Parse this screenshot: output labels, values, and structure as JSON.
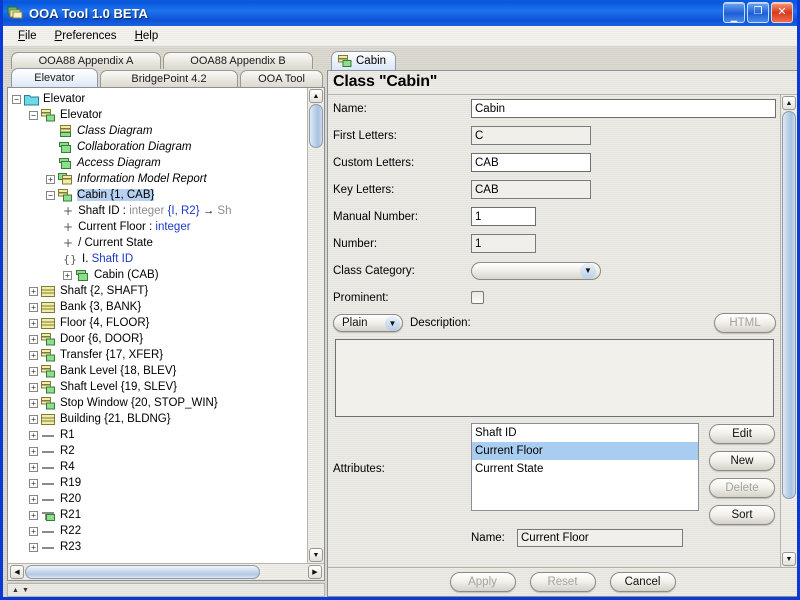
{
  "window": {
    "title": "OOA Tool 1.0 BETA",
    "icon": "app-folder-icon",
    "controls": {
      "minimize": "_",
      "maximize": "□",
      "close": "✕"
    }
  },
  "menubar": {
    "items": [
      "File",
      "Preferences",
      "Help"
    ]
  },
  "left": {
    "tabs_row1": [
      {
        "label": "OOA88 Appendix A",
        "selected": false
      },
      {
        "label": "OOA88 Appendix B",
        "selected": false
      }
    ],
    "tabs_row2": [
      {
        "label": "Elevator",
        "selected": true
      },
      {
        "label": "BridgePoint 4.2",
        "selected": false
      },
      {
        "label": "OOA Tool",
        "selected": false
      }
    ],
    "tree": [
      {
        "indent": 0,
        "toggle": "minus",
        "icon": "folder-cyan-icon",
        "label": "Elevator",
        "italic": false,
        "selected": false
      },
      {
        "indent": 1,
        "toggle": "minus",
        "icon": "stack-green-yellow-icon",
        "label": "Elevator",
        "italic": false,
        "selected": false
      },
      {
        "indent": 2,
        "toggle": "none",
        "icon": "stack-yellow-icon",
        "label": "Class Diagram",
        "italic": true,
        "selected": false
      },
      {
        "indent": 2,
        "toggle": "none",
        "icon": "square-green-icon",
        "label": "Collaboration Diagram",
        "italic": true,
        "selected": false
      },
      {
        "indent": 2,
        "toggle": "none",
        "icon": "square-green-icon",
        "label": "Access Diagram",
        "italic": true,
        "selected": false
      },
      {
        "indent": 2,
        "toggle": "plus",
        "icon": "stack-yellow-green-icon",
        "label": "Information Model Report",
        "italic": true,
        "selected": false
      },
      {
        "indent": 2,
        "toggle": "minus",
        "icon": "stack-green-yellow-icon",
        "label": "Cabin {1, CAB}",
        "italic": false,
        "selected": true
      },
      {
        "indent": 3,
        "toggle": "attr",
        "icon": "none",
        "label": "Shaft ID : integer {I, R2} → Sh",
        "italic": false,
        "selected": false,
        "parts": [
          {
            "t": "Shaft ID : ",
            "c": "black"
          },
          {
            "t": "integer ",
            "c": "gray"
          },
          {
            "t": "{I, R2}",
            "c": "blue"
          },
          {
            "t": " → ",
            "c": "black"
          },
          {
            "t": "Sh",
            "c": "gray"
          }
        ]
      },
      {
        "indent": 3,
        "toggle": "attr",
        "icon": "none",
        "label": "Current Floor : integer",
        "italic": false,
        "selected": false,
        "parts": [
          {
            "t": "Current Floor : ",
            "c": "black"
          },
          {
            "t": "integer",
            "c": "blue"
          }
        ]
      },
      {
        "indent": 3,
        "toggle": "attr",
        "icon": "none",
        "label": "/ Current State",
        "italic": false,
        "selected": false,
        "parts": [
          {
            "t": "/ Current State",
            "c": "black"
          }
        ]
      },
      {
        "indent": 3,
        "toggle": "ident",
        "icon": "none",
        "label": "I. Shaft ID",
        "italic": false,
        "selected": false,
        "parts": [
          {
            "t": "I. ",
            "c": "black"
          },
          {
            "t": "Shaft ID",
            "c": "blue"
          }
        ]
      },
      {
        "indent": 3,
        "toggle": "plus",
        "icon": "square-green-icon",
        "label": "Cabin (CAB)",
        "italic": false,
        "selected": false
      },
      {
        "indent": 1,
        "toggle": "plus",
        "icon": "lines-yellow-icon",
        "label": "Shaft {2, SHAFT}",
        "italic": false,
        "selected": false
      },
      {
        "indent": 1,
        "toggle": "plus",
        "icon": "lines-yellow-icon",
        "label": "Bank {3, BANK}",
        "italic": false,
        "selected": false
      },
      {
        "indent": 1,
        "toggle": "plus",
        "icon": "lines-yellow-icon",
        "label": "Floor {4, FLOOR}",
        "italic": false,
        "selected": false
      },
      {
        "indent": 1,
        "toggle": "plus",
        "icon": "stack-green-yellow-icon",
        "label": "Door {6, DOOR}",
        "italic": false,
        "selected": false
      },
      {
        "indent": 1,
        "toggle": "plus",
        "icon": "stack-green-yellow-icon",
        "label": "Transfer {17, XFER}",
        "italic": false,
        "selected": false
      },
      {
        "indent": 1,
        "toggle": "plus",
        "icon": "stack-green-yellow-icon",
        "label": "Bank Level {18, BLEV}",
        "italic": false,
        "selected": false
      },
      {
        "indent": 1,
        "toggle": "plus",
        "icon": "stack-green-yellow-icon",
        "label": "Shaft Level {19, SLEV}",
        "italic": false,
        "selected": false
      },
      {
        "indent": 1,
        "toggle": "plus",
        "icon": "stack-green-yellow-icon",
        "label": "Stop Window {20, STOP_WIN}",
        "italic": false,
        "selected": false
      },
      {
        "indent": 1,
        "toggle": "plus",
        "icon": "lines-yellow-icon",
        "label": "Building {21, BLDNG}",
        "italic": false,
        "selected": false
      },
      {
        "indent": 1,
        "toggle": "plus",
        "icon": "dash-icon",
        "label": "R1",
        "italic": false,
        "selected": false
      },
      {
        "indent": 1,
        "toggle": "plus",
        "icon": "dash-icon",
        "label": "R2",
        "italic": false,
        "selected": false
      },
      {
        "indent": 1,
        "toggle": "plus",
        "icon": "dash-icon",
        "label": "R4",
        "italic": false,
        "selected": false
      },
      {
        "indent": 1,
        "toggle": "plus",
        "icon": "dash-icon",
        "label": "R19",
        "italic": false,
        "selected": false
      },
      {
        "indent": 1,
        "toggle": "plus",
        "icon": "dash-icon",
        "label": "R20",
        "italic": false,
        "selected": false
      },
      {
        "indent": 1,
        "toggle": "plus",
        "icon": "dash-green-icon",
        "label": "R21",
        "italic": false,
        "selected": false
      },
      {
        "indent": 1,
        "toggle": "plus",
        "icon": "dash-icon",
        "label": "R22",
        "italic": false,
        "selected": false
      },
      {
        "indent": 1,
        "toggle": "plus",
        "icon": "dash-icon",
        "label": "R23",
        "italic": false,
        "selected": false
      }
    ]
  },
  "right": {
    "tab": {
      "label": "Cabin",
      "icon": "stack-green-yellow-icon"
    },
    "panel_title": "Class \"Cabin\"",
    "fields": [
      {
        "label": "Name:",
        "value": "Cabin",
        "width": "long",
        "readonly": false
      },
      {
        "label": "First Letters:",
        "value": "C",
        "width": "med",
        "readonly": true
      },
      {
        "label": "Custom Letters:",
        "value": "CAB",
        "width": "med",
        "readonly": false
      },
      {
        "label": "Key Letters:",
        "value": "CAB",
        "width": "med",
        "readonly": true
      },
      {
        "label": "Manual Number:",
        "value": "1",
        "width": "short",
        "readonly": false
      },
      {
        "label": "Number:",
        "value": "1",
        "width": "short",
        "readonly": true
      }
    ],
    "class_category": {
      "label": "Class Category:",
      "value": "",
      "arrow": "▼"
    },
    "prominent": {
      "label": "Prominent:",
      "checked": false
    },
    "description": {
      "style_combo": "Plain",
      "style_arrow": "▼",
      "label": "Description:",
      "html_button": "HTML",
      "text": ""
    },
    "attributes": {
      "label": "Attributes:",
      "items": [
        {
          "label": "Shaft ID",
          "selected": false
        },
        {
          "label": "Current Floor",
          "selected": true
        },
        {
          "label": "Current State",
          "selected": false
        }
      ],
      "buttons": [
        {
          "label": "Edit",
          "disabled": false
        },
        {
          "label": "New",
          "disabled": false
        },
        {
          "label": "Delete",
          "disabled": true
        },
        {
          "label": "Sort",
          "disabled": false
        }
      ],
      "name_row": {
        "label": "Name:",
        "value": "Current Floor"
      }
    },
    "bottom_buttons": [
      {
        "label": "Apply",
        "disabled": true
      },
      {
        "label": "Reset",
        "disabled": true
      },
      {
        "label": "Cancel",
        "disabled": false
      }
    ]
  },
  "colors": {
    "titlebar": "#1b63e0",
    "selection": "#b7d2f0",
    "list_selection": "#a8cdf0",
    "panel_bg": "#e9e7e1",
    "accent_blue": "#1d39c4"
  }
}
